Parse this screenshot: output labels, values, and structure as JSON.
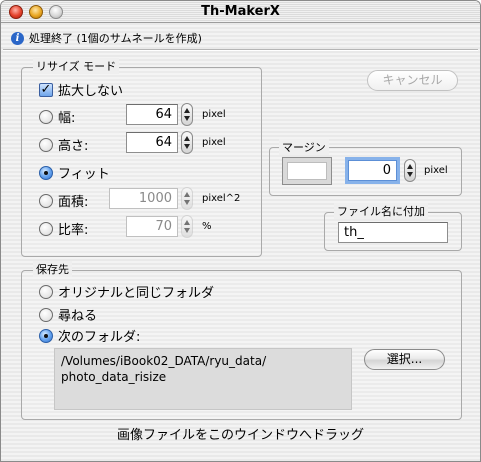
{
  "window": {
    "title": "Th-MakerX"
  },
  "status": {
    "text": "処理終了 (1個のサムネールを作成)"
  },
  "resize": {
    "group_label": "リサイズ モード",
    "no_enlarge": {
      "label": "拡大しない",
      "checked": true
    },
    "width": {
      "label": "幅:",
      "value": "64",
      "unit": "pixel"
    },
    "height": {
      "label": "高さ:",
      "value": "64",
      "unit": "pixel"
    },
    "fit": {
      "label": "フィット"
    },
    "area": {
      "label": "面積:",
      "value": "1000",
      "unit": "pixel^2"
    },
    "ratio": {
      "label": "比率:",
      "value": "70",
      "unit": "%"
    },
    "selected": "fit"
  },
  "cancel_button": {
    "label": "キャンセル"
  },
  "margin": {
    "group_label": "マージン",
    "value": "0",
    "unit": "pixel",
    "color": "#ffffff"
  },
  "filename_suffix": {
    "group_label": "ファイル名に付加",
    "value": "th_"
  },
  "save": {
    "group_label": "保存先",
    "options": [
      "オリジナルと同じフォルダ",
      "尋ねる",
      "次のフォルダ:"
    ],
    "selected": "次のフォルダ:",
    "path": "/Volumes/iBook02_DATA/ryu_data/photo_data_risize",
    "path_line1": "/Volumes/iBook02_DATA/ryu_data/",
    "path_line2": "photo_data_risize",
    "choose_button": "選択..."
  },
  "drop_hint": "画像ファイルをこのウインドウへドラッグ"
}
